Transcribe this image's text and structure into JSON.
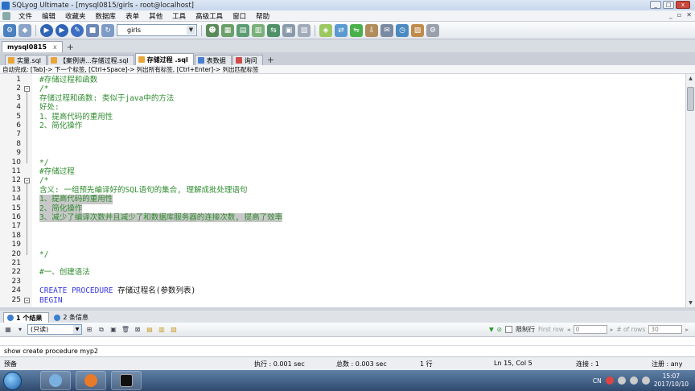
{
  "window": {
    "title": "SQLyog Ultimate - [mysql0815/girls - root@localhost]",
    "buttons": [
      "_",
      "□",
      "x"
    ]
  },
  "menubar": {
    "items": [
      "文件",
      "编辑",
      "收藏夹",
      "数据库",
      "表单",
      "其他",
      "工具",
      "高级工具",
      "窗口",
      "帮助"
    ]
  },
  "toolbar": {
    "db_select": "girls"
  },
  "connection_tab": {
    "label": "mysql0815",
    "close": "x"
  },
  "query_tabs": [
    {
      "label": "实量.sql",
      "active": false,
      "color": "#e8a53a"
    },
    {
      "label": "【案例讲...存储过程.sql",
      "active": false,
      "color": "#e8a53a"
    },
    {
      "label": "存储过程 .sql",
      "active": true,
      "color": "#e8a53a"
    },
    {
      "label": "表数据",
      "active": false,
      "color": "#4a7fd0"
    },
    {
      "label": "询问",
      "active": false,
      "color": "#d04a4a"
    }
  ],
  "autocomplete_hint": "自动完成: [Tab]-> 下一个标签, [Ctrl+Space]-> 列出所有标签, [Ctrl+Enter]-> 列出匹配标签",
  "editor": {
    "lines": [
      {
        "n": "1",
        "text": "#存储过程和函数",
        "style": "comment"
      },
      {
        "n": "2",
        "text": "/*",
        "style": "comment",
        "fold": "-"
      },
      {
        "n": "3",
        "text": "存储过程和函数: 类似于java中的方法",
        "style": "comment"
      },
      {
        "n": "4",
        "text": "好处:",
        "style": "comment"
      },
      {
        "n": "5",
        "text": "1、提高代码的重用性",
        "style": "comment"
      },
      {
        "n": "6",
        "text": "2、简化操作",
        "style": "comment"
      },
      {
        "n": "7",
        "text": "",
        "style": "comment"
      },
      {
        "n": "8",
        "text": "",
        "style": "comment"
      },
      {
        "n": "9",
        "text": "",
        "style": "comment"
      },
      {
        "n": "10",
        "text": "*/",
        "style": "comment"
      },
      {
        "n": "11",
        "text": "#存储过程",
        "style": "comment"
      },
      {
        "n": "12",
        "text": "/*",
        "style": "comment",
        "fold": "-"
      },
      {
        "n": "13",
        "text": "含义: 一组预先编译好的SQL语句的集合, 理解成批处理语句",
        "style": "comment"
      },
      {
        "n": "14",
        "text": "1、提高代码的重用性",
        "style": "comment",
        "selected": true
      },
      {
        "n": "15",
        "text": "2、简化操作",
        "style": "comment",
        "selected": true
      },
      {
        "n": "16",
        "text": "3、减少了编译次数并且减少了和数据库服务器的连接次数, 提高了效率",
        "style": "comment",
        "selected": true
      },
      {
        "n": "17",
        "text": "",
        "style": "comment"
      },
      {
        "n": "18",
        "text": "",
        "style": "comment"
      },
      {
        "n": "19",
        "text": "",
        "style": "comment"
      },
      {
        "n": "20",
        "text": "*/",
        "style": "comment"
      },
      {
        "n": "21",
        "text": "",
        "style": "plain"
      },
      {
        "n": "22",
        "text": "#一、创建语法",
        "style": "comment"
      },
      {
        "n": "23",
        "text": "",
        "style": "plain"
      },
      {
        "n": "24",
        "text": "CREATE PROCEDURE 存储过程名(参数列表)",
        "style": "mixed",
        "kw": "CREATE PROCEDURE",
        "rest": " 存储过程名(参数列表)"
      },
      {
        "n": "25",
        "text": "BEGIN",
        "style": "kw",
        "fold": "-"
      }
    ]
  },
  "result_tabs": [
    {
      "label": "1 个结果",
      "active": true,
      "color": "#3a7fd0"
    },
    {
      "label": "2 条信息",
      "active": false,
      "color": "#3a7fd0"
    }
  ],
  "result_toolbar": {
    "readonly_select": "(只读)",
    "limit_rows_label": "限制行",
    "first_row_placeholder": "First row",
    "first_row_value": "0",
    "rows_placeholder": "# of rows",
    "rows_value": "30"
  },
  "sql_preview": "show create procedure  myp2",
  "statusbar": {
    "ready": "预备",
    "exec_time": "执行 : 0.001 sec",
    "total_time": "总数 : 0.003 sec",
    "rows": "1 行",
    "cursor": "Ln 15, Col 5",
    "connections": "连接 : 1",
    "user": "注册 : any"
  },
  "taskbar": {
    "ime": "CN",
    "time": "15:07",
    "date": "2017/10/10"
  },
  "colors": {
    "comment": "#2e8b2e",
    "keyword": "#3a3adf",
    "selection": "#c8c8c8"
  }
}
